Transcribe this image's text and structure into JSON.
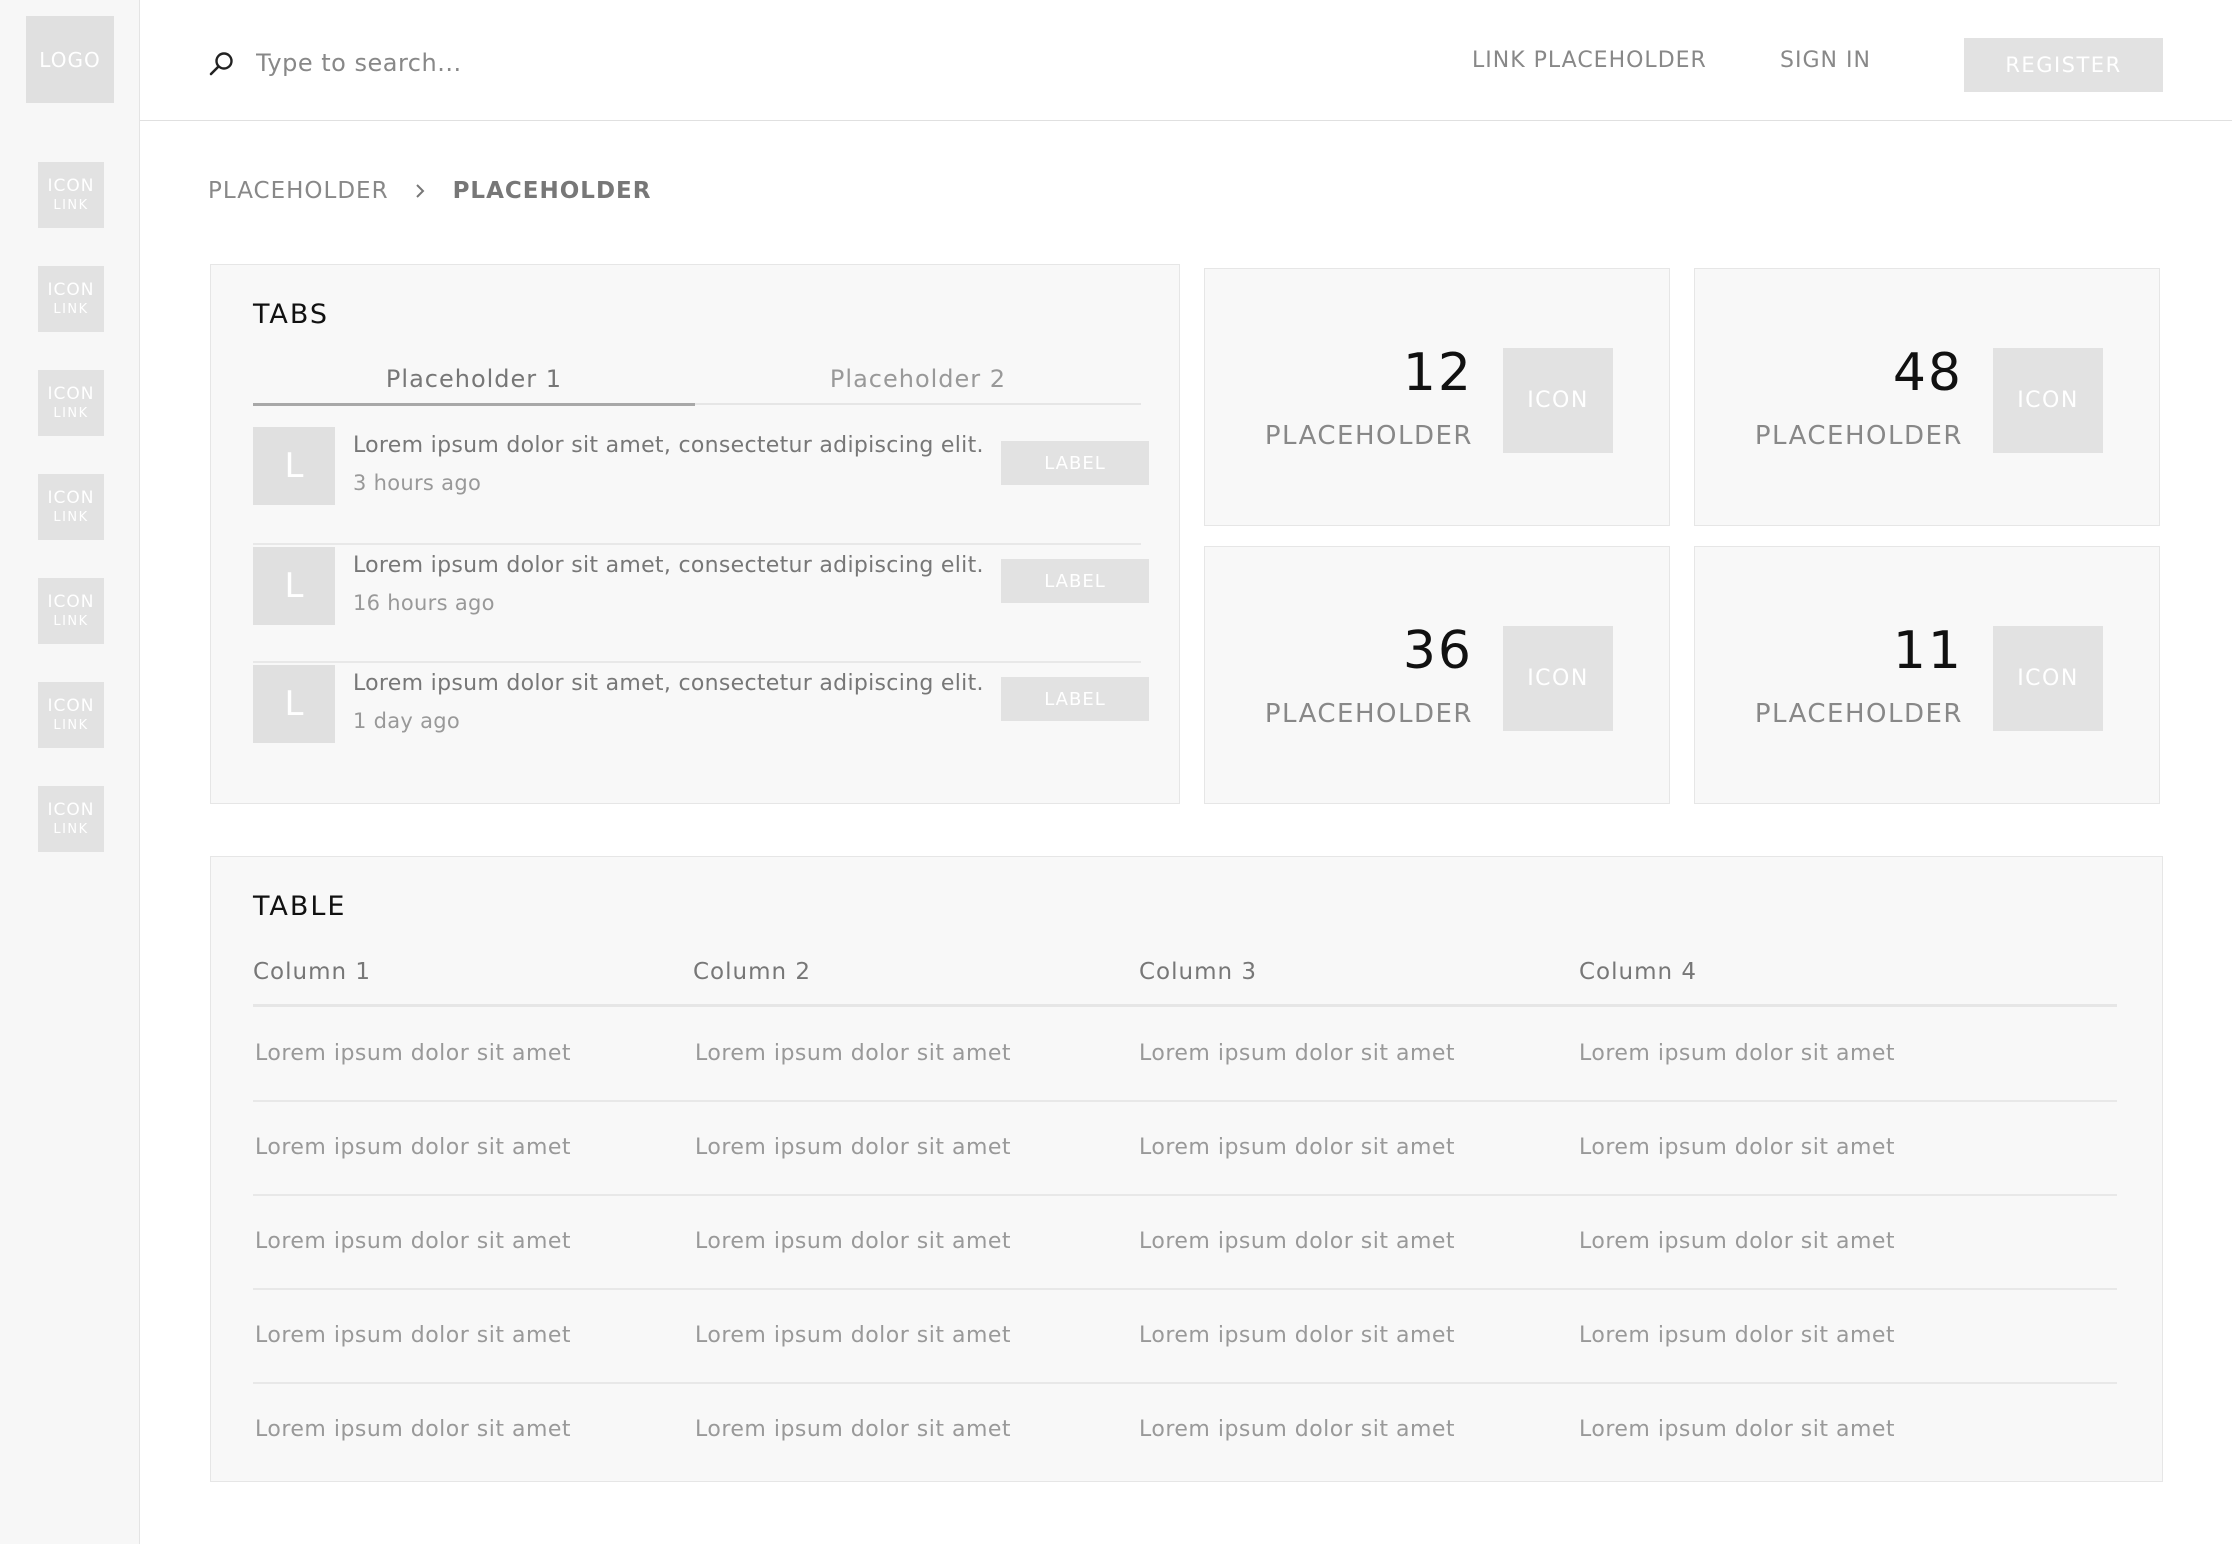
{
  "logo": "LOGO",
  "sidebar": {
    "items": [
      {
        "icon": "ICON",
        "link": "LINK"
      },
      {
        "icon": "ICON",
        "link": "LINK"
      },
      {
        "icon": "ICON",
        "link": "LINK"
      },
      {
        "icon": "ICON",
        "link": "LINK"
      },
      {
        "icon": "ICON",
        "link": "LINK"
      },
      {
        "icon": "ICON",
        "link": "LINK"
      },
      {
        "icon": "ICON",
        "link": "LINK"
      }
    ]
  },
  "header": {
    "search_placeholder": "Type to search...",
    "link_placeholder": "LINK PLACEHOLDER",
    "sign_in": "SIGN IN",
    "register": "REGISTER"
  },
  "breadcrumb": [
    "PLACEHOLDER",
    "PLACEHOLDER"
  ],
  "tabs_panel": {
    "title": "TABS",
    "tabs": [
      "Placeholder 1",
      "Placeholder 2"
    ],
    "active_tab": 0,
    "items": [
      {
        "avatar": "L",
        "text": "Lorem ipsum dolor sit amet, consectetur adipiscing elit.",
        "time": "3 hours ago",
        "label": "LABEL"
      },
      {
        "avatar": "L",
        "text": "Lorem ipsum dolor sit amet, consectetur adipiscing elit.",
        "time": "16 hours ago",
        "label": "LABEL"
      },
      {
        "avatar": "L",
        "text": "Lorem ipsum dolor sit amet, consectetur adipiscing elit.",
        "time": "1 day ago",
        "label": "LABEL"
      }
    ]
  },
  "stats": [
    {
      "value": "12",
      "label": "PLACEHOLDER",
      "icon": "ICON"
    },
    {
      "value": "48",
      "label": "PLACEHOLDER",
      "icon": "ICON"
    },
    {
      "value": "36",
      "label": "PLACEHOLDER",
      "icon": "ICON"
    },
    {
      "value": "11",
      "label": "PLACEHOLDER",
      "icon": "ICON"
    }
  ],
  "table": {
    "title": "TABLE",
    "columns": [
      "Column 1",
      "Column 2",
      "Column 3",
      "Column 4"
    ],
    "rows": [
      [
        "Lorem ipsum dolor sit amet",
        "Lorem ipsum dolor sit amet",
        "Lorem ipsum dolor sit amet",
        "Lorem ipsum dolor sit amet"
      ],
      [
        "Lorem ipsum dolor sit amet",
        "Lorem ipsum dolor sit amet",
        "Lorem ipsum dolor sit amet",
        "Lorem ipsum dolor sit amet"
      ],
      [
        "Lorem ipsum dolor sit amet",
        "Lorem ipsum dolor sit amet",
        "Lorem ipsum dolor sit amet",
        "Lorem ipsum dolor sit amet"
      ],
      [
        "Lorem ipsum dolor sit amet",
        "Lorem ipsum dolor sit amet",
        "Lorem ipsum dolor sit amet",
        "Lorem ipsum dolor sit amet"
      ],
      [
        "Lorem ipsum dolor sit amet",
        "Lorem ipsum dolor sit amet",
        "Lorem ipsum dolor sit amet",
        "Lorem ipsum dolor sit amet"
      ]
    ]
  },
  "colors": {
    "placeholder_block": "#e2e2e2",
    "panel_bg": "#f8f8f8",
    "sidebar_bg": "#f7f7f7",
    "heading": "#111111",
    "text": "#777777"
  }
}
